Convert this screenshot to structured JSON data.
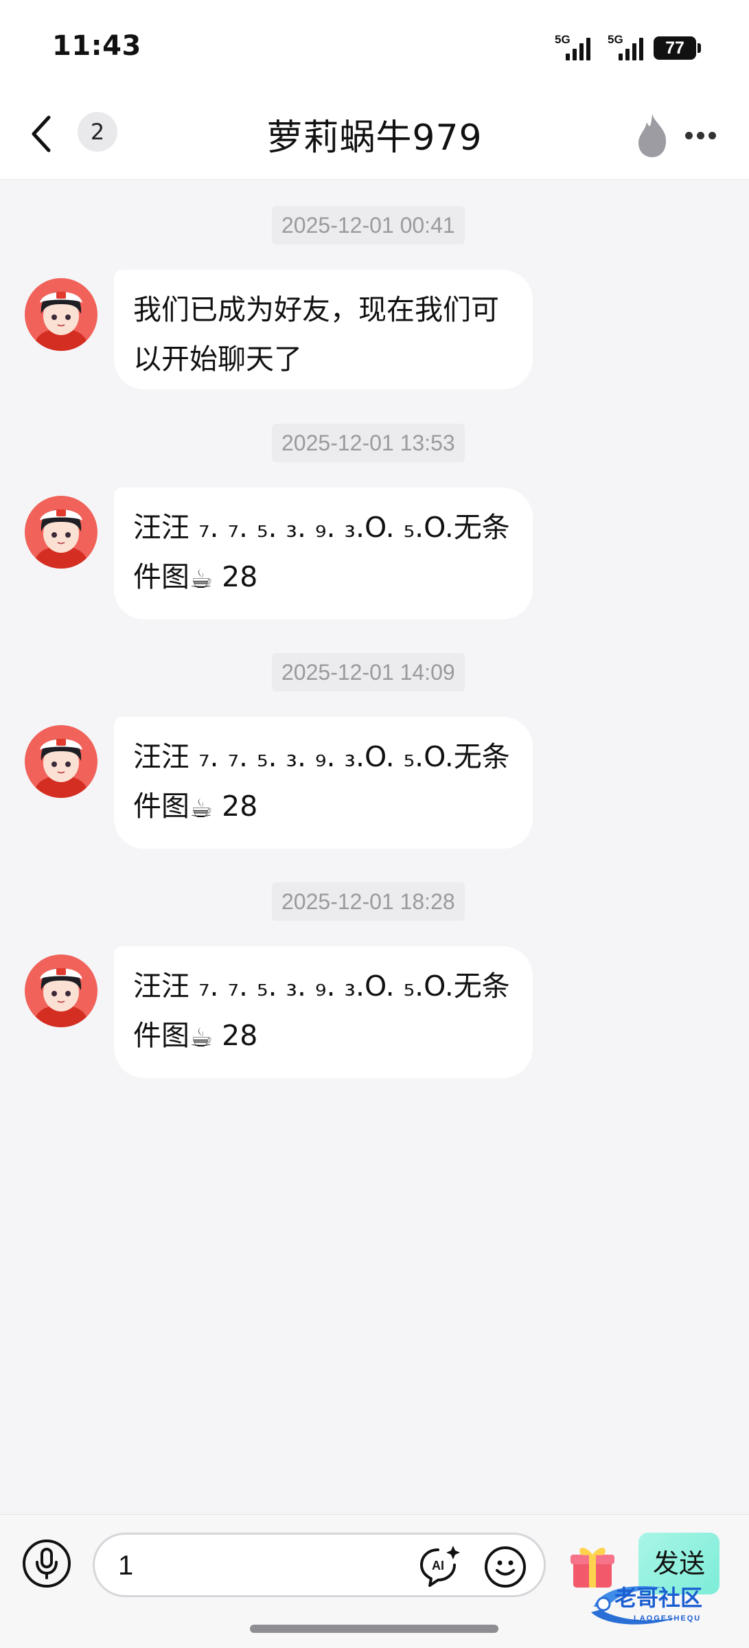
{
  "status_bar": {
    "time": "11:43",
    "signal_1_label": "5G",
    "signal_2_label": "5G",
    "battery": "77"
  },
  "header": {
    "unread_count": "2",
    "title": "萝莉蜗牛979"
  },
  "messages": [
    {
      "timestamp": "2025-12-01 00:41",
      "line1": "我们已成为好友，现在我们可",
      "line2": "以开始聊天了"
    },
    {
      "timestamp": "2025-12-01 13:53",
      "line1": "汪汪 ₇. ₇. ₅. ₃. ₉. ₃.O. ₅.O.无条",
      "line2": "件图",
      "emoji": "☕",
      "suffix": "28"
    },
    {
      "timestamp": "2025-12-01 14:09",
      "line1": "汪汪 ₇. ₇. ₅. ₃. ₉. ₃.O. ₅.O.无条",
      "line2": "件图",
      "emoji": "☕",
      "suffix": "28"
    },
    {
      "timestamp": "2025-12-01 18:28",
      "line1": "汪汪 ₇. ₇. ₅. ₃. ₉. ₃.O. ₅.O.无条",
      "line2": "件图",
      "emoji": "☕",
      "suffix": "28"
    }
  ],
  "input_bar": {
    "input_value": "1",
    "ai_label": "AI",
    "send_label": "发送"
  },
  "watermark": {
    "text": "老哥社区",
    "subtext": "LAOGESHEQU"
  },
  "colors": {
    "background": "#f5f5f7",
    "bubble": "#ffffff",
    "send_button": "#7dedd8",
    "timestamp_text": "#9a9a9e"
  },
  "icons": [
    "back-chevron-icon",
    "flame-icon",
    "more-icon",
    "microphone-icon",
    "ai-assistant-icon",
    "emoji-icon",
    "gift-icon",
    "coffee-icon"
  ]
}
